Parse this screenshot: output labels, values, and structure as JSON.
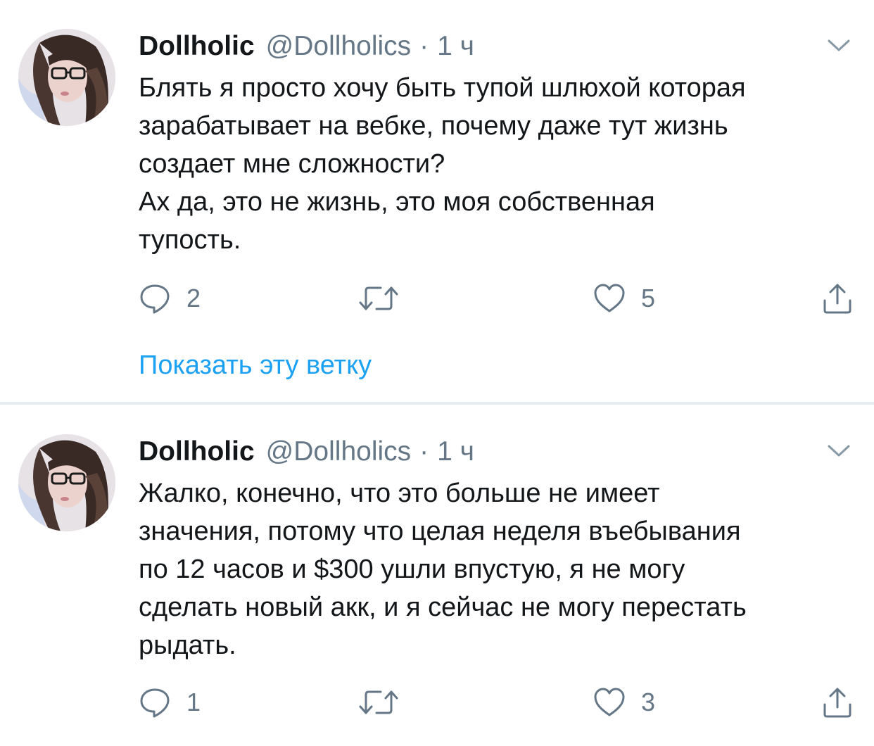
{
  "tweets": [
    {
      "display_name": "Dollholic",
      "handle": "@Dollholics",
      "separator_dot": "·",
      "time": "1 ч",
      "text_lines": [
        "Блять я просто хочу быть тупой шлюхой которая",
        "зарабатывает на вебке, почему даже тут жизнь",
        "создает мне сложности?",
        "Ах да, это не жизнь, это моя собственная",
        "тупость."
      ],
      "replies": "2",
      "retweets": "",
      "likes": "5",
      "show_thread": "Показать эту ветку"
    },
    {
      "display_name": "Dollholic",
      "handle": "@Dollholics",
      "separator_dot": "·",
      "time": "1 ч",
      "text_lines": [
        "Жалко, конечно, что это больше не имеет",
        "значения, потому что целая неделя въебывания",
        "по 12 часов и $300 ушли впустую, я не могу",
        "сделать новый акк, и я сейчас не могу перестать",
        "рыдать."
      ],
      "replies": "1",
      "retweets": "",
      "likes": "3"
    }
  ],
  "icons": {
    "reply": "reply-icon",
    "retweet": "retweet-icon",
    "like": "heart-icon",
    "share": "share-icon",
    "menu": "chevron-down-icon"
  },
  "colors": {
    "primary_text": "#14171a",
    "secondary_text": "#657786",
    "link": "#1da1f2",
    "divider": "#e6ecf0"
  }
}
